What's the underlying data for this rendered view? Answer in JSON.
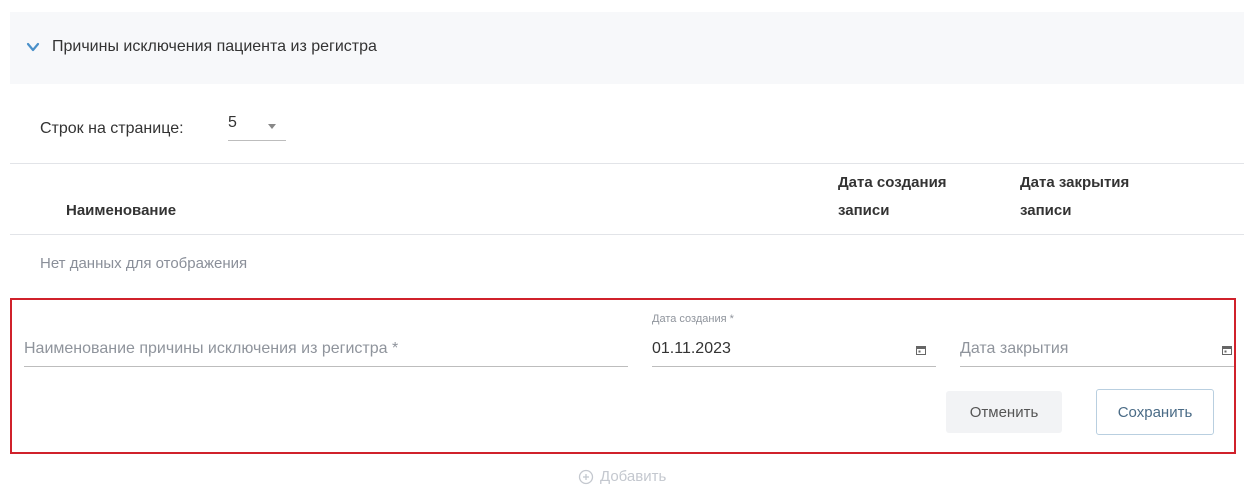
{
  "section": {
    "title": "Причины исключения пациента из регистра"
  },
  "pagination": {
    "rows_label": "Строк на странице:",
    "rows_value": "5"
  },
  "table": {
    "columns": [
      {
        "label": "Наименование"
      },
      {
        "line1": "Дата создания",
        "line2": "записи"
      },
      {
        "line1": "Дата закрытия",
        "line2": "записи"
      }
    ],
    "empty_text": "Нет данных для отображения"
  },
  "form": {
    "name_placeholder": "Наименование причины исключения из регистра *",
    "created_label": "Дата создания *",
    "created_value": "01.11.2023",
    "closed_placeholder": "Дата закрытия",
    "cancel_label": "Отменить",
    "save_label": "Сохранить"
  },
  "add": {
    "label": "Добавить"
  },
  "colors": {
    "accent": "#4a90c9",
    "highlight_border": "#d0212b"
  },
  "icons": [
    "chevron-down-icon",
    "dropdown-arrow-icon",
    "calendar-icon",
    "plus-circle-icon"
  ]
}
